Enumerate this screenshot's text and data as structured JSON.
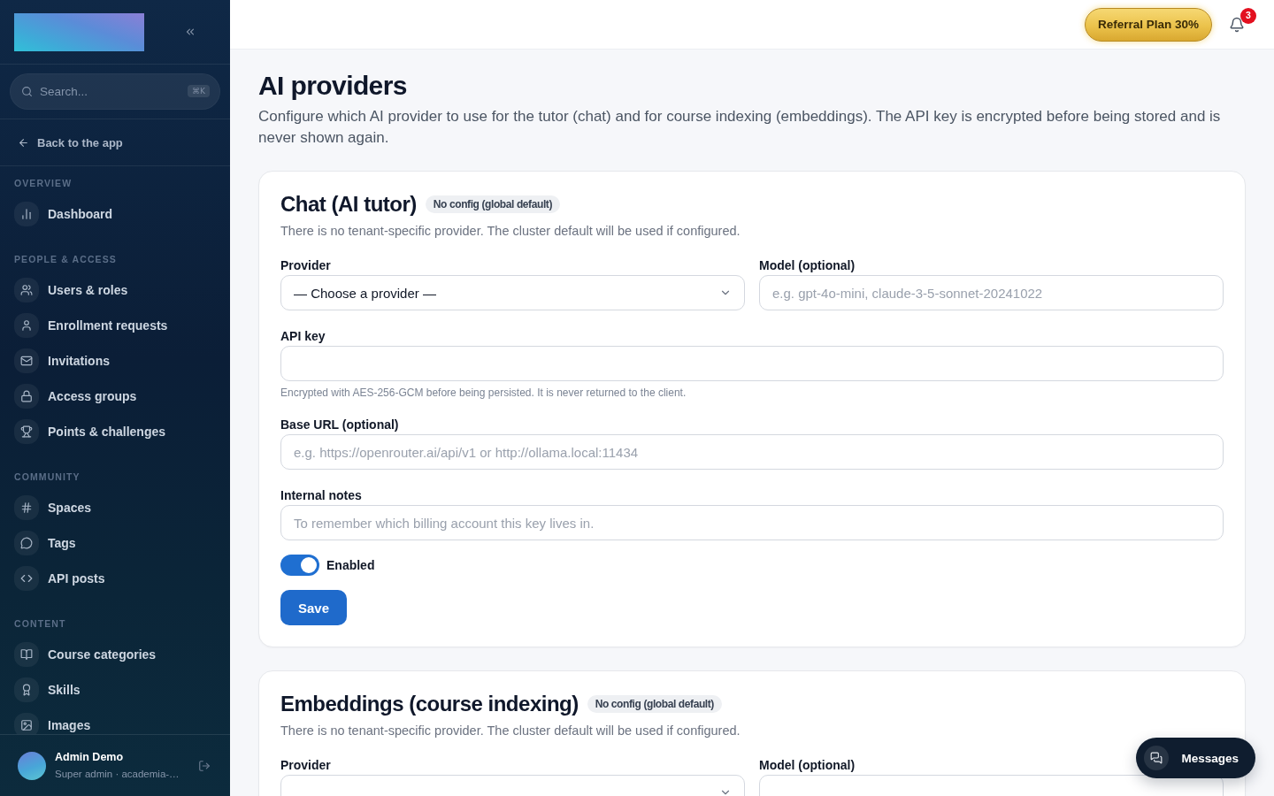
{
  "sidebar": {
    "search": {
      "placeholder": "Search...",
      "shortcut": "⌘K"
    },
    "back_link": "Back to the app",
    "sections": [
      {
        "title": "OVERVIEW",
        "items": [
          {
            "label": "Dashboard",
            "selected": false
          }
        ]
      },
      {
        "title": "PEOPLE & ACCESS",
        "items": [
          {
            "label": "Users & roles",
            "selected": false
          },
          {
            "label": "Enrollment requests",
            "selected": false
          },
          {
            "label": "Invitations",
            "selected": false
          },
          {
            "label": "Access groups",
            "selected": false
          },
          {
            "label": "Points & challenges",
            "selected": false
          }
        ]
      },
      {
        "title": "COMMUNITY",
        "items": [
          {
            "label": "Spaces",
            "selected": false
          },
          {
            "label": "Tags",
            "selected": false
          },
          {
            "label": "API posts",
            "selected": false
          }
        ]
      },
      {
        "title": "CONTENT",
        "items": [
          {
            "label": "Course categories",
            "selected": false
          },
          {
            "label": "Skills",
            "selected": false
          },
          {
            "label": "Images",
            "selected": false
          }
        ]
      }
    ],
    "user": {
      "name": "Admin Demo",
      "subtitle": "Super admin · academia-…"
    }
  },
  "header": {
    "referral_button": "Referral Plan 30%",
    "notification_count": "3"
  },
  "page": {
    "title": "AI providers",
    "description": "Configure which AI provider to use for the tutor (chat) and for course indexing (embeddings). The API key is encrypted before being stored and is never shown again."
  },
  "cards": [
    {
      "title": "Chat (AI tutor)",
      "badge": "No config (global default)",
      "description": "There is no tenant-specific provider. The cluster default will be used if configured.",
      "rows": [
        {
          "fields": [
            {
              "kind": "select",
              "label": "Provider",
              "value": "— Choose a provider —"
            },
            {
              "kind": "text",
              "label": "Model (optional)",
              "placeholder": "e.g. gpt-4o-mini, claude-3-5-sonnet-20241022"
            }
          ]
        },
        {
          "fields": [
            {
              "kind": "password",
              "label": "API key",
              "hint": "Encrypted with AES-256-GCM before being persisted. It is never returned to the client."
            }
          ]
        },
        {
          "fields": [
            {
              "kind": "text",
              "label": "Base URL (optional)",
              "placeholder": "e.g. https://openrouter.ai/api/v1 or http://ollama.local:11434"
            }
          ]
        },
        {
          "fields": [
            {
              "kind": "text",
              "label": "Internal notes",
              "placeholder": "To remember which billing account this key lives in."
            }
          ]
        }
      ],
      "toggle": {
        "label": "Enabled",
        "on": true
      },
      "save_button": "Save"
    },
    {
      "title": "Embeddings (course indexing)",
      "badge": "No config (global default)",
      "description": "There is no tenant-specific provider. The cluster default will be used if configured.",
      "rows": [
        {
          "fields": [
            {
              "kind": "select",
              "label": "Provider"
            },
            {
              "kind": "text",
              "label": "Model (optional)"
            }
          ]
        }
      ]
    }
  ],
  "messages_button": "Messages"
}
